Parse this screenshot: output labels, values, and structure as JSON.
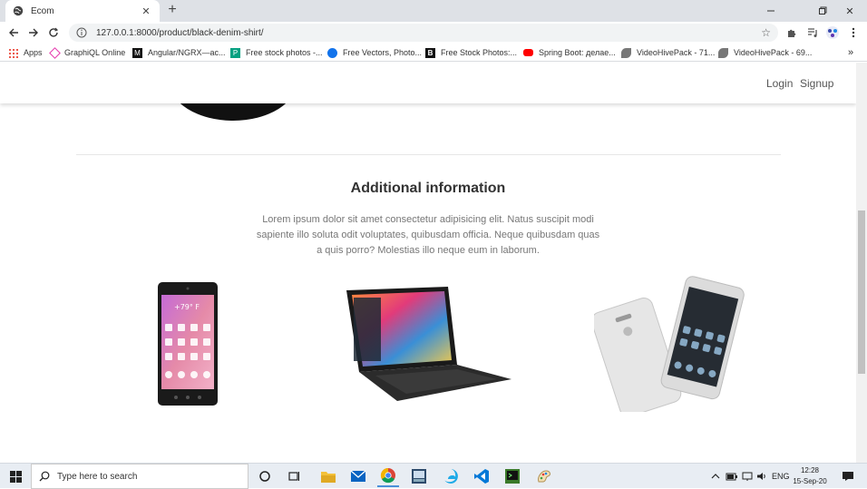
{
  "browser": {
    "tab_title": "Ecom",
    "url": "127.0.0.1:8000/product/black-denim-shirt/",
    "bookmarks": [
      {
        "label": "Apps"
      },
      {
        "label": "GraphiQL Online"
      },
      {
        "label": "Angular/NGRX—ас..."
      },
      {
        "label": "Free stock photos -..."
      },
      {
        "label": "Free Vectors, Photo..."
      },
      {
        "label": "Free Stock Photos:..."
      },
      {
        "label": "Spring Boot: делае..."
      },
      {
        "label": "VideoHivePack - 71..."
      },
      {
        "label": "VideoHivePack - 69..."
      }
    ]
  },
  "site": {
    "nav": {
      "login": "Login",
      "signup": "Signup"
    },
    "section_title": "Additional information",
    "section_text": "Lorem ipsum dolor sit amet consectetur adipisicing elit. Natus suscipit modi sapiente illo soluta odit voluptates, quibusdam officia. Neque quibusdam quas a quis porro? Molestias illo neque eum in laborum.",
    "phone_screen_temp": "+79° F"
  },
  "taskbar": {
    "search_placeholder": "Type here to search",
    "language": "ENG",
    "time": "12:28",
    "date": "15-Sep-20"
  },
  "colors": {
    "footer": "#2b2b2b",
    "nav_text": "#555555",
    "heading": "#333333",
    "body_text": "#777777"
  }
}
